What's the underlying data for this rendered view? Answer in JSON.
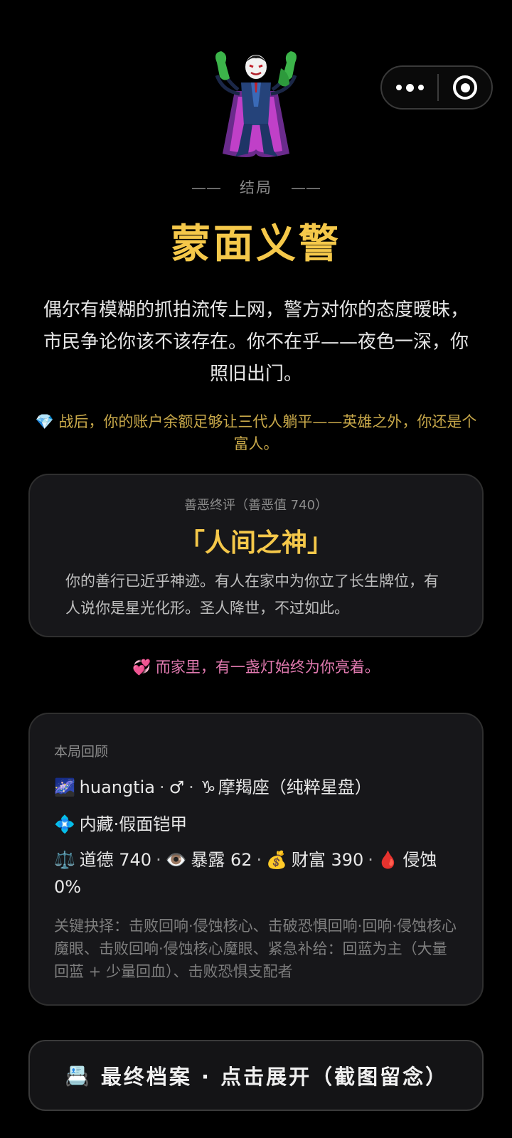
{
  "capsule": {
    "more_icon": "more-dots-icon",
    "close_icon": "target-close-icon"
  },
  "hero": {
    "icon": "supervillain-emoji"
  },
  "ending": {
    "label": "结局",
    "title": "蒙面义警",
    "description": "偶尔有模糊的抓拍流传上网，警方对你的态度暧昧，市民争论你该不该存在。你不在乎——夜色一深，你照旧出门。",
    "wealth_emoji": "💎",
    "wealth_text": "战后，你的账户余额足够让三代人躺平——英雄之外，你还是个富人。"
  },
  "verdict": {
    "subtitle": "善恶终评（善恶值 740）",
    "title": "「人间之神」",
    "text": "你的善行已近乎神迹。有人在家中为你立了长生牌位，有人说你是星光化形。圣人降世，不过如此。"
  },
  "family": {
    "emoji": "💞",
    "text": "而家里，有一盏灯始终为你亮着。"
  },
  "recap": {
    "heading": "本局回顾",
    "line1": {
      "emoji": "🌌",
      "name": "huangtia",
      "gender": "♂",
      "zodiac_emoji": "♑",
      "zodiac": "摩羯座（纯粹星盘）"
    },
    "line2": {
      "emoji": "💠",
      "text": "内藏·假面铠甲"
    },
    "stats": {
      "morality_emoji": "⚖️",
      "morality": "道德 740",
      "exposure_emoji": "👁️",
      "exposure": "暴露 62",
      "wealth_emoji": "💰",
      "wealth": "财富 390",
      "corruption_emoji": "🩸",
      "corruption": "侵蚀 0%"
    },
    "key_choices": "关键抉择：击败回响·侵蚀核心、击破恐惧回响·回响·侵蚀核心魔眼、击败回响·侵蚀核心魔眼、紧急补给：回蓝为主（大量回蓝 + 少量回血）、击败恐惧支配者"
  },
  "archive_button": {
    "emoji": "📇",
    "label": "最终档案 · 点击展开（截图留念）"
  },
  "colors": {
    "gold": "#f5c84a",
    "pink": "#e27ab0",
    "card_bg": "#17171a"
  }
}
